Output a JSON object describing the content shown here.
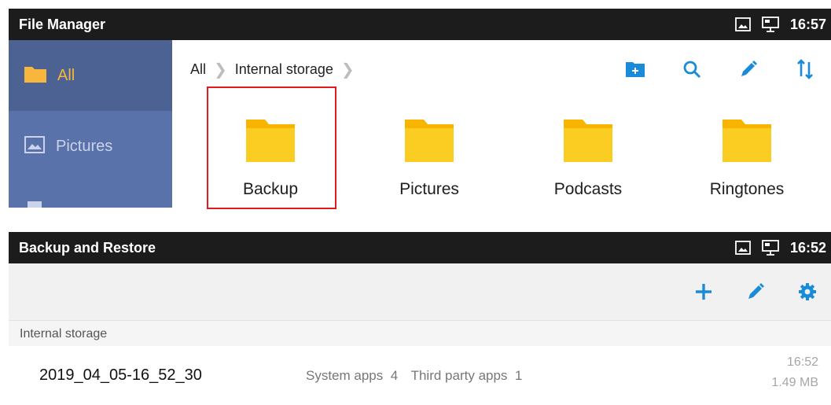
{
  "file_manager": {
    "title": "File Manager",
    "status_time": "16:57",
    "sidebar": {
      "items": [
        {
          "label": "All",
          "icon": "folder-icon",
          "selected": true
        },
        {
          "label": "Pictures",
          "icon": "image-icon",
          "selected": false
        }
      ]
    },
    "breadcrumb": [
      "All",
      "Internal storage"
    ],
    "toolbar_icons": [
      "new-folder-icon",
      "search-icon",
      "edit-icon",
      "sort-icon"
    ],
    "folders": [
      {
        "name": "Backup",
        "highlighted": true
      },
      {
        "name": "Pictures"
      },
      {
        "name": "Podcasts"
      },
      {
        "name": "Ringtones"
      }
    ]
  },
  "backup_restore": {
    "title": "Backup and Restore",
    "status_time": "16:52",
    "toolbar_icons": [
      "add-icon",
      "edit-icon",
      "settings-icon"
    ],
    "section_label": "Internal storage",
    "entries": [
      {
        "name": "2019_04_05-16_52_30",
        "system_apps": "System apps  4",
        "third_party_apps": "Third party apps  1",
        "time": "16:52",
        "size": "1.49 MB"
      }
    ]
  },
  "colors": {
    "status_bar": "#1c1c1c",
    "sidebar": "#5a72aa",
    "sidebar_selected": "#4b6293",
    "accent_blue": "#1a8bd8",
    "folder_yellow": "#f9c413",
    "highlight_red": "#e11b1b"
  }
}
